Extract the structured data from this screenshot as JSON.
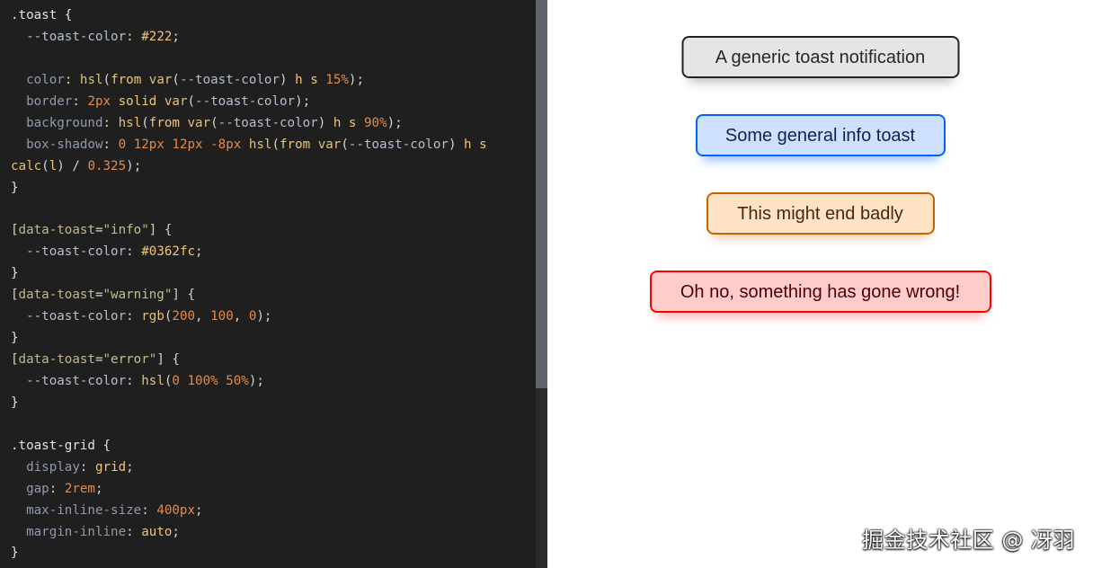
{
  "editor": {
    "code_lines": [
      [
        {
          "c": "selector",
          "t": ".toast {"
        }
      ],
      [
        {
          "c": "plain",
          "t": "  "
        },
        {
          "c": "var",
          "t": "--toast-color"
        },
        {
          "c": "plain",
          "t": ": "
        },
        {
          "c": "kw",
          "t": "#222"
        },
        {
          "c": "plain",
          "t": ";"
        }
      ],
      [
        {
          "c": "plain",
          "t": ""
        }
      ],
      [
        {
          "c": "plain",
          "t": "  "
        },
        {
          "c": "prop",
          "t": "color"
        },
        {
          "c": "plain",
          "t": ": "
        },
        {
          "c": "func",
          "t": "hsl"
        },
        {
          "c": "plain",
          "t": "("
        },
        {
          "c": "kw",
          "t": "from"
        },
        {
          "c": "plain",
          "t": " "
        },
        {
          "c": "func",
          "t": "var"
        },
        {
          "c": "plain",
          "t": "("
        },
        {
          "c": "var",
          "t": "--toast-color"
        },
        {
          "c": "plain",
          "t": ") "
        },
        {
          "c": "kw",
          "t": "h s"
        },
        {
          "c": "plain",
          "t": " "
        },
        {
          "c": "num",
          "t": "15%"
        },
        {
          "c": "plain",
          "t": ");"
        }
      ],
      [
        {
          "c": "plain",
          "t": "  "
        },
        {
          "c": "prop",
          "t": "border"
        },
        {
          "c": "plain",
          "t": ": "
        },
        {
          "c": "num",
          "t": "2px"
        },
        {
          "c": "plain",
          "t": " "
        },
        {
          "c": "kw",
          "t": "solid"
        },
        {
          "c": "plain",
          "t": " "
        },
        {
          "c": "func",
          "t": "var"
        },
        {
          "c": "plain",
          "t": "("
        },
        {
          "c": "var",
          "t": "--toast-color"
        },
        {
          "c": "plain",
          "t": ");"
        }
      ],
      [
        {
          "c": "plain",
          "t": "  "
        },
        {
          "c": "prop",
          "t": "background"
        },
        {
          "c": "plain",
          "t": ": "
        },
        {
          "c": "func",
          "t": "hsl"
        },
        {
          "c": "plain",
          "t": "("
        },
        {
          "c": "kw",
          "t": "from"
        },
        {
          "c": "plain",
          "t": " "
        },
        {
          "c": "func",
          "t": "var"
        },
        {
          "c": "plain",
          "t": "("
        },
        {
          "c": "var",
          "t": "--toast-color"
        },
        {
          "c": "plain",
          "t": ") "
        },
        {
          "c": "kw",
          "t": "h s"
        },
        {
          "c": "plain",
          "t": " "
        },
        {
          "c": "num",
          "t": "90%"
        },
        {
          "c": "plain",
          "t": ");"
        }
      ],
      [
        {
          "c": "plain",
          "t": "  "
        },
        {
          "c": "prop",
          "t": "box-shadow"
        },
        {
          "c": "plain",
          "t": ": "
        },
        {
          "c": "num",
          "t": "0 12px 12px -8px"
        },
        {
          "c": "plain",
          "t": " "
        },
        {
          "c": "func",
          "t": "hsl"
        },
        {
          "c": "plain",
          "t": "("
        },
        {
          "c": "kw",
          "t": "from"
        },
        {
          "c": "plain",
          "t": " "
        },
        {
          "c": "func",
          "t": "var"
        },
        {
          "c": "plain",
          "t": "("
        },
        {
          "c": "var",
          "t": "--toast-color"
        },
        {
          "c": "plain",
          "t": ") "
        },
        {
          "c": "kw",
          "t": "h s"
        }
      ],
      [
        {
          "c": "func",
          "t": "calc"
        },
        {
          "c": "plain",
          "t": "("
        },
        {
          "c": "kw",
          "t": "l"
        },
        {
          "c": "plain",
          "t": ") / "
        },
        {
          "c": "num",
          "t": "0.325"
        },
        {
          "c": "plain",
          "t": ");"
        }
      ],
      [
        {
          "c": "selector",
          "t": "}"
        }
      ],
      [
        {
          "c": "plain",
          "t": ""
        }
      ],
      [
        {
          "c": "plain",
          "t": "["
        },
        {
          "c": "attr",
          "t": "data-toast"
        },
        {
          "c": "plain",
          "t": "="
        },
        {
          "c": "str",
          "t": "\"info\""
        },
        {
          "c": "plain",
          "t": "] {"
        }
      ],
      [
        {
          "c": "plain",
          "t": "  "
        },
        {
          "c": "var",
          "t": "--toast-color"
        },
        {
          "c": "plain",
          "t": ": "
        },
        {
          "c": "kw",
          "t": "#0362fc"
        },
        {
          "c": "plain",
          "t": ";"
        }
      ],
      [
        {
          "c": "selector",
          "t": "}"
        }
      ],
      [
        {
          "c": "plain",
          "t": "["
        },
        {
          "c": "attr",
          "t": "data-toast"
        },
        {
          "c": "plain",
          "t": "="
        },
        {
          "c": "str",
          "t": "\"warning\""
        },
        {
          "c": "plain",
          "t": "] {"
        }
      ],
      [
        {
          "c": "plain",
          "t": "  "
        },
        {
          "c": "var",
          "t": "--toast-color"
        },
        {
          "c": "plain",
          "t": ": "
        },
        {
          "c": "func",
          "t": "rgb"
        },
        {
          "c": "plain",
          "t": "("
        },
        {
          "c": "num",
          "t": "200"
        },
        {
          "c": "plain",
          "t": ", "
        },
        {
          "c": "num",
          "t": "100"
        },
        {
          "c": "plain",
          "t": ", "
        },
        {
          "c": "num",
          "t": "0"
        },
        {
          "c": "plain",
          "t": ");"
        }
      ],
      [
        {
          "c": "selector",
          "t": "}"
        }
      ],
      [
        {
          "c": "plain",
          "t": "["
        },
        {
          "c": "attr",
          "t": "data-toast"
        },
        {
          "c": "plain",
          "t": "="
        },
        {
          "c": "str",
          "t": "\"error\""
        },
        {
          "c": "plain",
          "t": "] {"
        }
      ],
      [
        {
          "c": "plain",
          "t": "  "
        },
        {
          "c": "var",
          "t": "--toast-color"
        },
        {
          "c": "plain",
          "t": ": "
        },
        {
          "c": "func",
          "t": "hsl"
        },
        {
          "c": "plain",
          "t": "("
        },
        {
          "c": "num",
          "t": "0 100% 50%"
        },
        {
          "c": "plain",
          "t": ");"
        }
      ],
      [
        {
          "c": "selector",
          "t": "}"
        }
      ],
      [
        {
          "c": "plain",
          "t": ""
        }
      ],
      [
        {
          "c": "selector",
          "t": ".toast-grid {"
        }
      ],
      [
        {
          "c": "plain",
          "t": "  "
        },
        {
          "c": "prop",
          "t": "display"
        },
        {
          "c": "plain",
          "t": ": "
        },
        {
          "c": "kw",
          "t": "grid"
        },
        {
          "c": "plain",
          "t": ";"
        }
      ],
      [
        {
          "c": "plain",
          "t": "  "
        },
        {
          "c": "prop",
          "t": "gap"
        },
        {
          "c": "plain",
          "t": ": "
        },
        {
          "c": "num",
          "t": "2rem"
        },
        {
          "c": "plain",
          "t": ";"
        }
      ],
      [
        {
          "c": "plain",
          "t": "  "
        },
        {
          "c": "prop",
          "t": "max-inline-size"
        },
        {
          "c": "plain",
          "t": ": "
        },
        {
          "c": "num",
          "t": "400px"
        },
        {
          "c": "plain",
          "t": ";"
        }
      ],
      [
        {
          "c": "plain",
          "t": "  "
        },
        {
          "c": "prop",
          "t": "margin-inline"
        },
        {
          "c": "plain",
          "t": ": "
        },
        {
          "c": "kw",
          "t": "auto"
        },
        {
          "c": "plain",
          "t": ";"
        }
      ],
      [
        {
          "c": "selector",
          "t": "}"
        }
      ]
    ]
  },
  "preview": {
    "toasts": {
      "generic": "A generic toast notification",
      "info": "Some general info toast",
      "warning": "This might end badly",
      "error": "Oh no, something has gone wrong!"
    }
  },
  "watermark": "掘金技术社区 @ 冴羽"
}
